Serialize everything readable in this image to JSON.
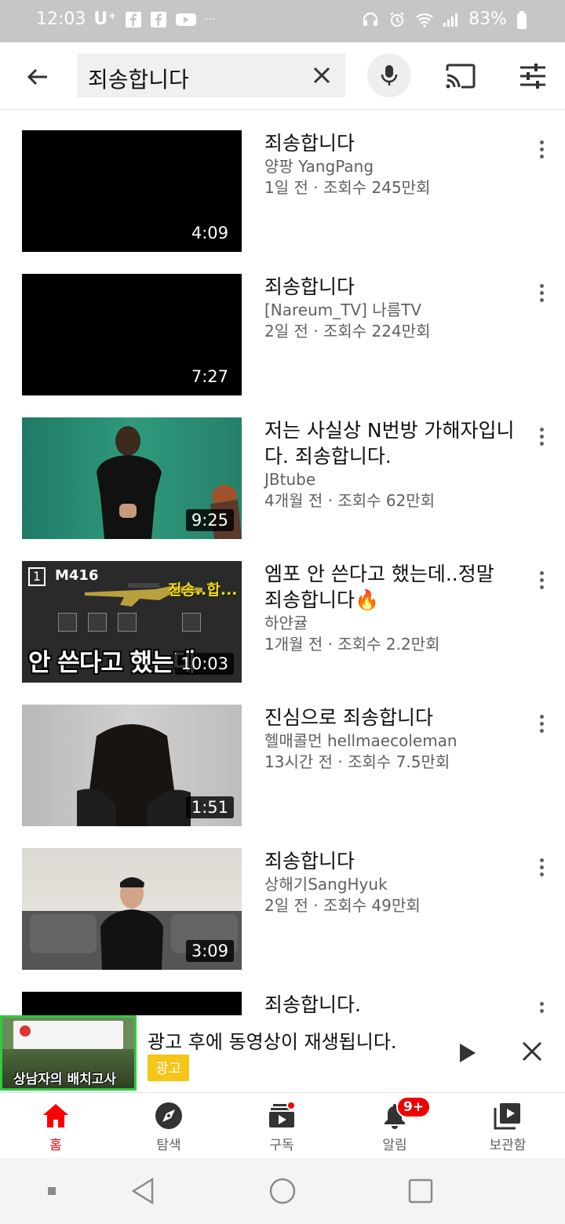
{
  "status_bar": {
    "time": "12:03",
    "carrier": "U⁺",
    "battery": "83%"
  },
  "search": {
    "query": "죄송합니다"
  },
  "results": [
    {
      "title": "죄송합니다",
      "channel": "양팡 YangPang",
      "stats": "1일 전 · 조회수 245만회",
      "duration": "4:09"
    },
    {
      "title": "죄송합니다",
      "channel": "[Nareum_TV] 나름TV",
      "stats": "2일 전 · 조회수 224만회",
      "duration": "7:27"
    },
    {
      "title": "저는 사실상 N번방 가해자입니다. 죄송합니다.",
      "channel": "JBtube",
      "stats": "4개월 전 · 조회수 62만회",
      "duration": "9:25"
    },
    {
      "title": "엠포 안 쓴다고 했는데..정말 죄송합니다🔥",
      "channel": "하얀귤",
      "stats": "1개월 전 · 조회수 2.2만회",
      "duration": "10:03"
    },
    {
      "title": "진심으로 죄송합니다",
      "channel": "헬매콜먼 hellmaecoleman",
      "stats": "13시간 전 · 조회수 7.5만회",
      "duration": "1:51"
    },
    {
      "title": "죄송합니다",
      "channel": "상해기SangHyuk",
      "stats": "2일 전 · 조회수 49만회",
      "duration": "3:09"
    },
    {
      "title": "죄송합니다.",
      "channel": "",
      "stats": "",
      "duration": ""
    }
  ],
  "thumb_texts": {
    "r4_weapon": "M416",
    "r4_slot": "1",
    "r4_overlay": "진송..합...",
    "r4_caption": "안 쓴다고 했는데"
  },
  "ad": {
    "text": "광고 후에 동영상이 재생됩니다.",
    "badge": "광고",
    "thumb_caption": "상남자의 배치고사"
  },
  "bottom_nav": [
    {
      "label": "홈",
      "icon": "home-icon",
      "active": true
    },
    {
      "label": "탐색",
      "icon": "explore-icon",
      "active": false
    },
    {
      "label": "구독",
      "icon": "subscriptions-icon",
      "active": false
    },
    {
      "label": "알림",
      "icon": "bell-icon",
      "active": false,
      "badge": "9+"
    },
    {
      "label": "보관함",
      "icon": "library-icon",
      "active": false
    }
  ],
  "colors": {
    "accent": "#ff0000",
    "ad_badge": "#f5c518"
  }
}
